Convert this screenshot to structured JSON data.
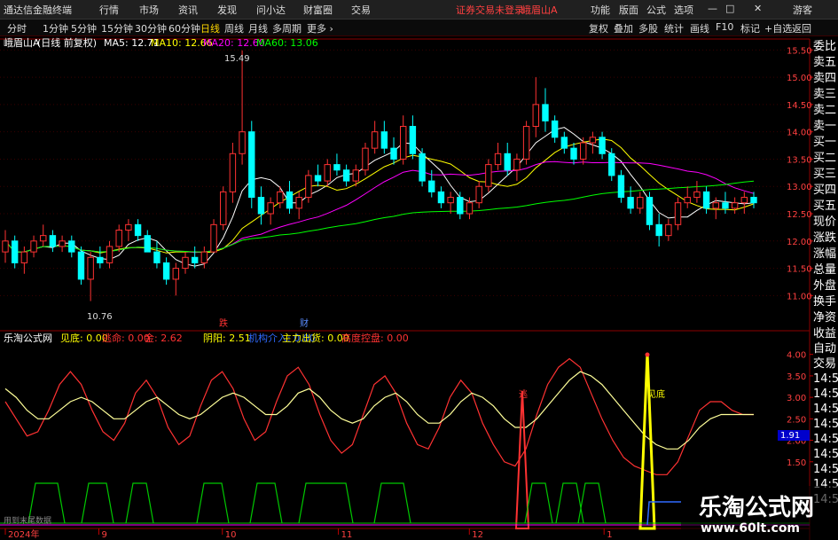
{
  "app": {
    "title": "通达信金融终端"
  },
  "menu": [
    "行情",
    "市场",
    "资讯",
    "发现",
    "问小达",
    "财富圈",
    "交易"
  ],
  "status": {
    "login": "证券交易未登录",
    "stock": "峨眉山A"
  },
  "right_menu": [
    "功能",
    "版面",
    "公式",
    "选项"
  ],
  "window_btns": {
    "min": "—",
    "max": "□",
    "close": "✕",
    "guest": "游客"
  },
  "periods": [
    "分时",
    "1分钟",
    "5分钟",
    "15分钟",
    "30分钟",
    "60分钟",
    "日线",
    "周线",
    "月线",
    "多周期",
    "更多 ›"
  ],
  "active_period": "日线",
  "tool_buttons": [
    "复权",
    "叠加",
    "多股",
    "统计",
    "画线",
    "F10",
    "标记",
    "+自选",
    "返回"
  ],
  "main_header": {
    "stock": "峨眉山A",
    "mode": "(日线 前复权)",
    "ma5": "MA5: 12.71",
    "ma10": "MA10: 12.66",
    "ma20": "MA20: 12.60",
    "ma60": "MA60: 13.06"
  },
  "sub_header": {
    "name": "乐淘公式网",
    "a": "见底: 0.00",
    "b": "逃命: 0.00",
    "c": "金: 2.62",
    "d": "阴阳: 2.51",
    "e": "机构介入: 0.00",
    "f": "主力出货: 0.00",
    "g": "高度控盘: 0.00"
  },
  "sidebar_top": [
    "委比",
    "卖五",
    "卖四",
    "卖三",
    "卖二",
    "卖一",
    "买一",
    "买二",
    "买三",
    "买四",
    "买五",
    "现价",
    "涨跌",
    "涨幅",
    "总量",
    "外盘",
    "换手",
    "净资",
    "收益"
  ],
  "sidebar_bottom": [
    "自动",
    "交易",
    "14:5",
    "14:5",
    "14:5",
    "14:5",
    "14:5",
    "14:5",
    "14:5",
    "14:5",
    "14:5"
  ],
  "footer": {
    "scroll_hint": "用到末尾数据"
  },
  "watermark": {
    "line1": "乐淘公式网",
    "line2": "www.60lt.com"
  },
  "colors": {
    "up": "#ff3232",
    "down": "#00ffff",
    "ma5": "#ffffff",
    "ma10": "#ffff00",
    "ma20": "#ff00ff",
    "ma60": "#00ff00",
    "grid": "#8b0000"
  },
  "chart_data": [
    {
      "type": "candlestick",
      "title": "峨眉山A (日线 前复权)",
      "ylim": [
        10.6,
        15.7
      ],
      "y_ticks": [
        11.0,
        11.5,
        12.0,
        12.5,
        13.0,
        13.5,
        14.0,
        14.5,
        15.0,
        15.5
      ],
      "x_ticks": [
        "2024年",
        "9",
        "10",
        "11",
        "12",
        "1"
      ],
      "annotations": {
        "high": "15.49",
        "low": "10.76",
        "events": [
          "跌",
          "财"
        ]
      },
      "ohlc": [
        [
          11.8,
          12.2,
          11.6,
          12.0
        ],
        [
          12.0,
          12.1,
          11.5,
          11.6
        ],
        [
          11.6,
          11.9,
          11.4,
          11.8
        ],
        [
          11.8,
          12.1,
          11.7,
          12.0
        ],
        [
          12.0,
          12.3,
          11.9,
          12.1
        ],
        [
          12.1,
          12.2,
          11.8,
          11.9
        ],
        [
          11.9,
          12.1,
          11.8,
          12.0
        ],
        [
          12.0,
          12.1,
          11.7,
          11.8
        ],
        [
          11.8,
          11.9,
          11.2,
          11.3
        ],
        [
          11.3,
          11.8,
          10.9,
          11.7
        ],
        [
          11.7,
          11.9,
          11.5,
          11.6
        ],
        [
          11.6,
          12.0,
          11.5,
          11.9
        ],
        [
          11.9,
          12.3,
          11.8,
          12.2
        ],
        [
          12.2,
          12.4,
          12.0,
          12.3
        ],
        [
          12.3,
          12.4,
          12.0,
          12.1
        ],
        [
          12.1,
          12.2,
          11.8,
          11.8
        ],
        [
          11.8,
          12.0,
          11.5,
          11.6
        ],
        [
          11.6,
          11.7,
          11.2,
          11.3
        ],
        [
          11.3,
          11.6,
          11.0,
          11.5
        ],
        [
          11.5,
          11.8,
          11.4,
          11.7
        ],
        [
          11.7,
          11.9,
          11.5,
          11.6
        ],
        [
          11.6,
          11.9,
          11.5,
          11.8
        ],
        [
          11.8,
          12.4,
          11.8,
          12.3
        ],
        [
          12.3,
          13.0,
          12.2,
          12.9
        ],
        [
          12.9,
          13.8,
          12.7,
          13.6
        ],
        [
          13.6,
          15.49,
          13.4,
          14.0
        ],
        [
          14.0,
          14.2,
          12.6,
          12.8
        ],
        [
          12.8,
          13.0,
          12.3,
          12.5
        ],
        [
          12.5,
          12.8,
          12.3,
          12.7
        ],
        [
          12.7,
          13.0,
          12.6,
          12.9
        ],
        [
          12.9,
          13.1,
          12.5,
          12.6
        ],
        [
          12.6,
          12.9,
          12.4,
          12.8
        ],
        [
          12.8,
          13.3,
          12.7,
          13.2
        ],
        [
          13.2,
          13.4,
          13.0,
          13.1
        ],
        [
          13.1,
          13.5,
          13.0,
          13.4
        ],
        [
          13.4,
          13.6,
          13.2,
          13.3
        ],
        [
          13.3,
          13.4,
          13.0,
          13.1
        ],
        [
          13.1,
          13.4,
          13.0,
          13.3
        ],
        [
          13.3,
          13.8,
          13.2,
          13.7
        ],
        [
          13.7,
          14.2,
          13.6,
          14.0
        ],
        [
          14.0,
          14.2,
          13.6,
          13.7
        ],
        [
          13.7,
          13.9,
          13.4,
          13.5
        ],
        [
          13.5,
          14.3,
          13.4,
          14.1
        ],
        [
          14.1,
          14.3,
          13.5,
          13.6
        ],
        [
          13.6,
          13.7,
          13.0,
          13.1
        ],
        [
          13.1,
          13.3,
          12.8,
          12.9
        ],
        [
          12.9,
          13.0,
          12.6,
          12.7
        ],
        [
          12.7,
          12.9,
          12.5,
          12.8
        ],
        [
          12.8,
          12.9,
          12.4,
          12.5
        ],
        [
          12.5,
          12.8,
          12.4,
          12.7
        ],
        [
          12.7,
          13.1,
          12.6,
          13.0
        ],
        [
          13.0,
          13.5,
          12.9,
          13.4
        ],
        [
          13.4,
          13.8,
          13.3,
          13.6
        ],
        [
          13.6,
          13.8,
          13.2,
          13.3
        ],
        [
          13.3,
          13.6,
          13.1,
          13.5
        ],
        [
          13.5,
          14.2,
          13.4,
          14.1
        ],
        [
          14.1,
          15.0,
          13.9,
          14.5
        ],
        [
          14.5,
          14.8,
          14.0,
          14.2
        ],
        [
          14.2,
          14.3,
          13.8,
          13.9
        ],
        [
          13.9,
          14.0,
          13.6,
          13.7
        ],
        [
          13.7,
          13.8,
          13.4,
          13.5
        ],
        [
          13.5,
          13.9,
          13.4,
          13.8
        ],
        [
          13.8,
          14.0,
          13.6,
          13.9
        ],
        [
          13.9,
          14.0,
          13.5,
          13.6
        ],
        [
          13.6,
          13.7,
          13.1,
          13.2
        ],
        [
          13.2,
          13.3,
          12.7,
          12.8
        ],
        [
          12.8,
          13.0,
          12.5,
          12.6
        ],
        [
          12.6,
          12.9,
          12.5,
          12.8
        ],
        [
          12.8,
          12.9,
          12.2,
          12.3
        ],
        [
          12.3,
          12.5,
          11.9,
          12.1
        ],
        [
          12.1,
          12.4,
          12.0,
          12.3
        ],
        [
          12.3,
          12.8,
          12.2,
          12.7
        ],
        [
          12.7,
          13.0,
          12.6,
          12.8
        ],
        [
          12.8,
          13.1,
          12.7,
          12.9
        ],
        [
          12.9,
          13.0,
          12.5,
          12.6
        ],
        [
          12.6,
          12.8,
          12.4,
          12.7
        ],
        [
          12.7,
          12.9,
          12.5,
          12.6
        ],
        [
          12.6,
          12.8,
          12.5,
          12.7
        ],
        [
          12.7,
          12.9,
          12.5,
          12.8
        ],
        [
          12.8,
          12.9,
          12.6,
          12.7
        ]
      ]
    },
    {
      "type": "line",
      "title": "乐淘公式网",
      "ylim": [
        1.0,
        4.2
      ],
      "y_ticks": [
        1.5,
        2.0,
        2.5,
        3.0,
        3.5,
        4.0
      ],
      "current_value": "1.91",
      "labels": [
        "逃",
        "见底"
      ],
      "series": [
        {
          "name": "金",
          "values": [
            2.9,
            2.5,
            2.1,
            2.2,
            2.7,
            3.3,
            3.6,
            3.3,
            2.7,
            2.2,
            2.0,
            2.4,
            3.1,
            3.4,
            3.0,
            2.3,
            1.9,
            2.1,
            2.8,
            3.4,
            3.6,
            3.2,
            2.5,
            2.0,
            2.2,
            2.9,
            3.5,
            3.7,
            3.3,
            2.6,
            2.0,
            1.7,
            1.9,
            2.6,
            3.3,
            3.5,
            3.1,
            2.4,
            1.9,
            1.8,
            2.3,
            3.0,
            3.4,
            3.1,
            2.4,
            1.9,
            1.5,
            1.4,
            1.8,
            2.6,
            3.3,
            3.7,
            3.9,
            3.7,
            3.1,
            2.5,
            2.0,
            1.6,
            1.4,
            1.3,
            1.2,
            1.2,
            1.5,
            2.1,
            2.7,
            2.9,
            2.9,
            2.7,
            2.6,
            2.6
          ]
        },
        {
          "name": "阴阳",
          "values": [
            3.2,
            3.0,
            2.7,
            2.5,
            2.5,
            2.7,
            2.9,
            3.0,
            2.9,
            2.7,
            2.5,
            2.5,
            2.7,
            2.9,
            3.0,
            2.8,
            2.6,
            2.5,
            2.6,
            2.8,
            3.0,
            3.1,
            3.0,
            2.8,
            2.6,
            2.6,
            2.8,
            3.1,
            3.2,
            3.0,
            2.7,
            2.5,
            2.4,
            2.5,
            2.8,
            3.0,
            3.1,
            2.9,
            2.6,
            2.4,
            2.4,
            2.6,
            2.9,
            3.1,
            3.0,
            2.8,
            2.5,
            2.3,
            2.3,
            2.5,
            2.8,
            3.1,
            3.4,
            3.6,
            3.5,
            3.3,
            3.0,
            2.7,
            2.4,
            2.1,
            1.9,
            1.8,
            1.8,
            2.0,
            2.3,
            2.5,
            2.6,
            2.6,
            2.6,
            2.6
          ]
        }
      ]
    }
  ]
}
